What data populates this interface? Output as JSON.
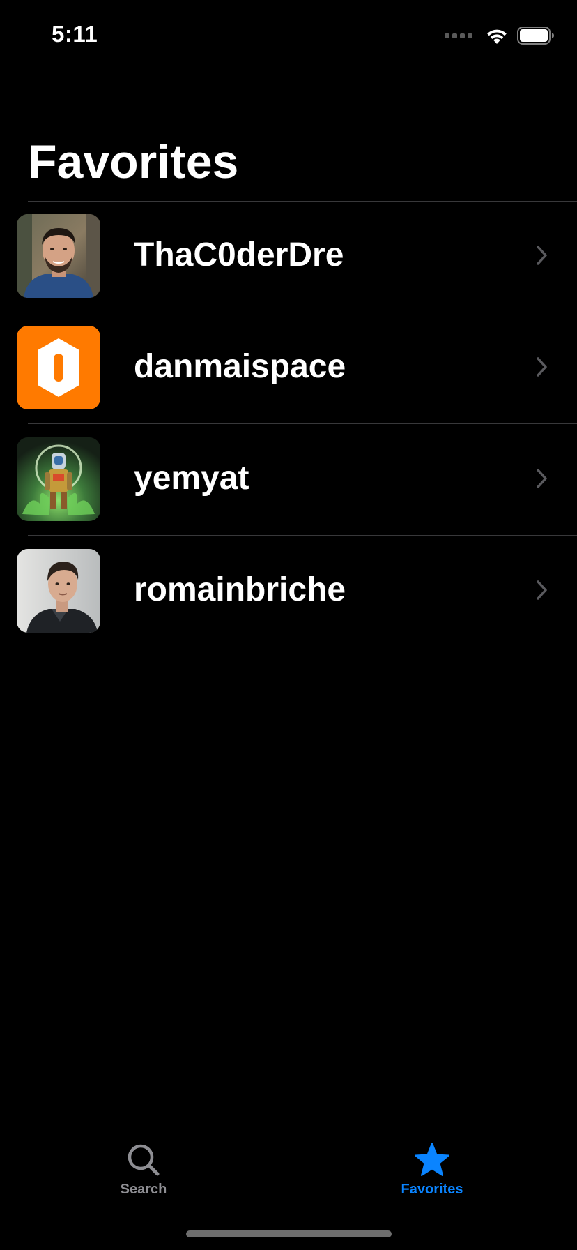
{
  "status_bar": {
    "time": "5:11"
  },
  "nav": {
    "title": "Favorites"
  },
  "favorites": [
    {
      "username": "ThaC0derDre",
      "avatar": "person-photo"
    },
    {
      "username": "danmaispace",
      "avatar": "orange-hexagon-logo"
    },
    {
      "username": "yemyat",
      "avatar": "robot-artwork"
    },
    {
      "username": "romainbriche",
      "avatar": "person-photo"
    }
  ],
  "tab_bar": {
    "items": [
      {
        "label": "Search",
        "icon": "magnifying-glass-icon",
        "selected": false
      },
      {
        "label": "Favorites",
        "icon": "star-icon",
        "selected": true
      }
    ]
  },
  "colors": {
    "background": "#000000",
    "text": "#ffffff",
    "accent": "#0a84ff",
    "inactive": "#8e8e93",
    "separator": "#38383a",
    "orange": "#ff7a00"
  }
}
